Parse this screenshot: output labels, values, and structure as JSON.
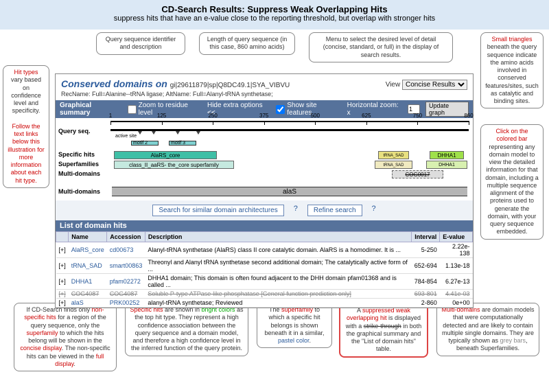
{
  "header": {
    "title": "CD-Search Results:  Suppress Weak Overlapping Hits",
    "subtitle": "suppress hits that have an e-value close to the reporting threshold, but overlap with stronger hits"
  },
  "callouts": {
    "c_queryid": "Query sequence identifier and description",
    "c_length": "Length of query sequence (in this case, 860 amino acids)",
    "c_menu": "Menu to select the desired level of detail (concise, standard, or full) in the display of search results.",
    "c_triangles": "Small triangles",
    "c_triangles_rest": " beneath the query sequence indicate the amino acids involved in conserved features/sites, such as catalytic and binding sites.",
    "c_hittypes_t": "Hit types",
    "c_hittypes_r": " vary based on confidence level and specificity.",
    "c_hittypes_follow": "Follow the text links below this illustration for more information about each hit type.",
    "c_clickbar": "Click on the colored bar",
    "c_clickbar_rest": " representing any domain model to view the detailed information for that domain, including a multiple sequence alignment of the proteins used to generate the domain, with your query sequence embedded.",
    "c_nonspec_a": "If  CD-Search finds only ",
    "c_nonspec_b": "non-specific hits",
    "c_nonspec_c": " for a region of the query sequence, only the ",
    "c_nonspec_d": "superfamily",
    "c_nonspec_e": " to which the hits belong will be shown in the ",
    "c_nonspec_f": "concise display",
    "c_nonspec_g": ". The non-specific hits can be viewed in the ",
    "c_nonspec_h": "full display",
    "c_spec_a": "Specific hits",
    "c_spec_b": " are shown in ",
    "c_spec_c": "bright colors",
    "c_spec_d": " as the top hit type. They represent a high confidence association between the query sequence and a domain model, and therefore a high confidence level in the inferred function of the query protein.",
    "c_super_a": "The ",
    "c_super_b": "superfamily",
    "c_super_c": " to which a specific hit belongs is shown beneath it in a similar, ",
    "c_super_d": "pastel color",
    "c_suppress_a": "A ",
    "c_suppress_b": "suppressed weak overlapping hit",
    "c_suppress_c": " is displayed with a ",
    "c_suppress_d": "strike-through",
    "c_suppress_e": " in both the graphical summary and the \"List of domain hits\" table.",
    "c_multi_a": "Multi-domains",
    "c_multi_b": " are domain models that were computationally detected and are likely to contain multiple single domains. They are typically shown as ",
    "c_multi_c": "grey bars",
    "c_multi_d": ", beneath Superfamilies."
  },
  "panel": {
    "title_prefix": "Conserved domains on ",
    "qid": "gi|29611879|sp|Q8DC49.1|SYA_VIBVU",
    "desc": "RecName: Full=Alanine--tRNA ligase; AltName: Full=Alanyl-tRNA synthetase;",
    "view_label": "View",
    "view_value": "Concise Results"
  },
  "bar": {
    "label": "Graphical summary",
    "zoom": "Zoom to residue level",
    "hide": "Hide extra options <<",
    "sitefeat": "Show site features",
    "hz": "Horizontal zoom: x",
    "hz_val": "1",
    "update": "Update graph"
  },
  "ruler": {
    "ticks": [
      "1",
      "125",
      "250",
      "375",
      "500",
      "625",
      "750",
      "860"
    ]
  },
  "motifs": {
    "active": "active site",
    "m2": "motif 2",
    "m3": "motif 3"
  },
  "rows": {
    "qseq": "Query seq.",
    "spec": "Specific hits",
    "sfam": "Superfamilies",
    "multid": "Multi-domains",
    "multi2": "Multi-domains"
  },
  "domains": {
    "alars": "AlaRS_core",
    "sfam": "class_II_aaRS- the_core superfamily",
    "dhha1": "DHHA1",
    "trnasad": "tRNA_SAD",
    "multi": "alaS",
    "cog1": "COG0017"
  },
  "midbtns": {
    "b1": "Search for similar domain architectures",
    "b2": "Refine search",
    "q": "?"
  },
  "listhead": "List of domain hits",
  "cols": {
    "name": "Name",
    "acc": "Accession",
    "desc": "Description",
    "int": "Interval",
    "ev": "E-value"
  },
  "rows_data": [
    {
      "n": "AlaRS_core",
      "a": "cd00673",
      "d": "Alanyl-tRNA synthetase (AlaRS) class II core catalytic domain. AlaRS is a homodimer. It is ...",
      "i": "5-250",
      "e": "2.22e-138",
      "s": false
    },
    {
      "n": "tRNA_SAD",
      "a": "smart00863",
      "d": "Threonyl and Alanyl tRNA synthetase second additional domain; The catalytically active form of ...",
      "i": "652-694",
      "e": "1.13e-18",
      "s": false
    },
    {
      "n": "DHHA1",
      "a": "pfam02272",
      "d": "DHHA1 domain; This domain is often found adjacent to the DHH domain pfam01368 and is called ...",
      "i": "784-854",
      "e": "6.27e-13",
      "s": false
    },
    {
      "n": "COG4087",
      "a": "COG4087",
      "d": "Soluble P-type ATPase-like phosphatase [General function prediction only]",
      "i": "693-801",
      "e": "4.41e-03",
      "s": true
    },
    {
      "n": "alaS",
      "a": "PRK00252",
      "d": "alanyl-tRNA synthetase; Reviewed",
      "i": "2-860",
      "e": "0e+00",
      "s": false
    }
  ]
}
